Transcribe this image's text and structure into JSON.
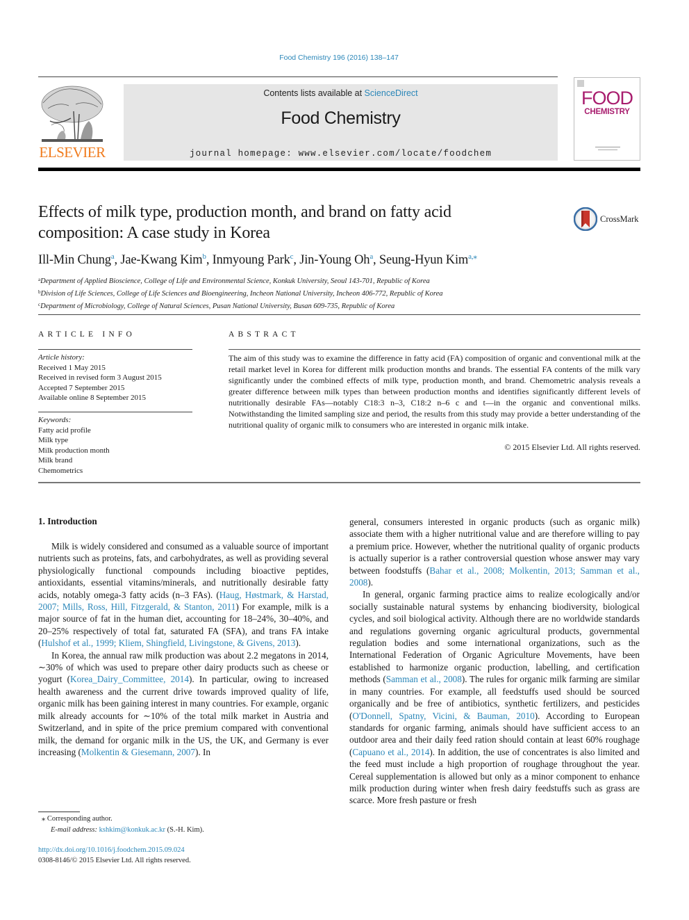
{
  "header": {
    "journal_ref": "Food Chemistry 196 (2016) 138–147",
    "contents_prefix": "Contents lists available at ",
    "contents_link": "ScienceDirect",
    "journal_title": "Food Chemistry",
    "homepage": "journal homepage: www.elsevier.com/locate/foodchem",
    "publisher_logo_text": "ELSEVIER",
    "cover_word_1": "FOOD",
    "cover_word_2": "CHEMISTRY",
    "crossmark_label": "CrossMark"
  },
  "colors": {
    "link": "#2a86b8",
    "elsevier_orange": "#f07b1d",
    "cover_magenta": "#a81d6e",
    "band_gray": "#e6e6e6"
  },
  "article": {
    "title": "Effects of milk type, production month, and brand on fatty acid composition: A case study in Korea",
    "authors": [
      {
        "name": "Ill-Min Chung",
        "aff": "a"
      },
      {
        "name": "Jae-Kwang Kim",
        "aff": "b"
      },
      {
        "name": "Inmyoung Park",
        "aff": "c"
      },
      {
        "name": "Jin-Young Oh",
        "aff": "a"
      },
      {
        "name": "Seung-Hyun Kim",
        "aff": "a,⁎"
      }
    ],
    "affiliations": [
      {
        "key": "a",
        "text": "Department of Applied Bioscience, College of Life and Environmental Science, Konkuk University, Seoul 143-701, Republic of Korea"
      },
      {
        "key": "b",
        "text": "Division of Life Sciences, College of Life Sciences and Bioengineering, Incheon National University, Incheon 406-772, Republic of Korea"
      },
      {
        "key": "c",
        "text": "Department of Microbiology, College of Natural Sciences, Pusan National University, Busan 609-735, Republic of Korea"
      }
    ]
  },
  "article_info": {
    "heading": "ARTICLE INFO",
    "history_label": "Article history:",
    "history": [
      "Received 1 May 2015",
      "Received in revised form 3 August 2015",
      "Accepted 7 September 2015",
      "Available online 8 September 2015"
    ],
    "keywords_label": "Keywords:",
    "keywords": [
      "Fatty acid profile",
      "Milk type",
      "Milk production month",
      "Milk brand",
      "Chemometrics"
    ]
  },
  "abstract": {
    "heading": "ABSTRACT",
    "text": "The aim of this study was to examine the difference in fatty acid (FA) composition of organic and conventional milk at the retail market level in Korea for different milk production months and brands. The essential FA contents of the milk vary significantly under the combined effects of milk type, production month, and brand. Chemometric analysis reveals a greater difference between milk types than between production months and identifies significantly different levels of nutritionally desirable FAs—notably C18:3 n–3, C18:2 n–6 c and t—in the organic and conventional milks. Notwithstanding the limited sampling size and period, the results from this study may provide a better understanding of the nutritional quality of organic milk to consumers who are interested in organic milk intake.",
    "copyright": "© 2015 Elsevier Ltd. All rights reserved."
  },
  "body": {
    "section_heading": "1. Introduction",
    "left": {
      "p1": [
        {
          "t": "Milk is widely considered and consumed as a valuable source of important nutrients such as proteins, fats, and carbohydrates, as well as providing several physiologically functional compounds including bioactive peptides, antioxidants, essential vitamins/minerals, and nutritionally desirable fatty acids, notably omega-3 fatty acids (n–3 FAs). ("
        },
        {
          "c": "Haug, Høstmark, & Harstad, 2007; Mills, Ross, Hill, Fitzgerald, & Stanton, 2011"
        },
        {
          "t": ") For example, milk is a major source of fat in the human diet, accounting for 18–24%, 30–40%, and 20–25% respectively of total fat, saturated FA (SFA), and trans FA intake ("
        },
        {
          "c": "Hulshof et al., 1999; Kliem, Shingfield, Livingstone, & Givens, 2013"
        },
        {
          "t": ")."
        }
      ],
      "p2": [
        {
          "t": "In Korea, the annual raw milk production was about 2.2 megatons in 2014, ∼30% of which was used to prepare other dairy products such as cheese or yogurt ("
        },
        {
          "c": "Korea_Dairy_Committee, 2014"
        },
        {
          "t": "). In particular, owing to increased health awareness and the current drive towards improved quality of life, organic milk has been gaining interest in many countries. For example, organic milk already accounts for ∼10% of the total milk market in Austria and Switzerland, and in spite of the price premium compared with conventional milk, the demand for organic milk in the US, the UK, and Germany is ever increasing ("
        },
        {
          "c": "Molkentin & Giesemann, 2007"
        },
        {
          "t": "). In"
        }
      ]
    },
    "right": {
      "p1": [
        {
          "t": "general, consumers interested in organic products (such as organic milk) associate them with a higher nutritional value and are therefore willing to pay a premium price. However, whether the nutritional quality of organic products is actually superior is a rather controversial question whose answer may vary between foodstuffs ("
        },
        {
          "c": "Bahar et al., 2008; Molkentin, 2013; Samman et al., 2008"
        },
        {
          "t": ")."
        }
      ],
      "p2": [
        {
          "t": "In general, organic farming practice aims to realize ecologically and/or socially sustainable natural systems by enhancing biodiversity, biological cycles, and soil biological activity. Although there are no worldwide standards and regulations governing organic agricultural products, governmental regulation bodies and some international organizations, such as the International Federation of Organic Agriculture Movements, have been established to harmonize organic production, labelling, and certification methods ("
        },
        {
          "c": "Samman et al., 2008"
        },
        {
          "t": "). The rules for organic milk farming are similar in many countries. For example, all feedstuffs used should be sourced organically and be free of antibiotics, synthetic fertilizers, and pesticides ("
        },
        {
          "c": "O'Donnell, Spatny, Vicini, & Bauman, 2010"
        },
        {
          "t": "). According to European standards for organic farming, animals should have sufficient access to an outdoor area and their daily feed ration should contain at least 60% roughage ("
        },
        {
          "c": "Capuano et al., 2014"
        },
        {
          "t": "). In addition, the use of concentrates is also limited and the feed must include a high proportion of roughage throughout the year. Cereal supplementation is allowed but only as a minor component to enhance milk production during winter when fresh dairy feedstuffs such as grass are scarce. More fresh pasture or fresh"
        }
      ]
    }
  },
  "footnotes": {
    "corresponding_mark": "⁎",
    "corresponding": "Corresponding author.",
    "email_label": "E-mail address: ",
    "email": "kshkim@konkuk.ac.kr",
    "email_suffix": " (S.-H. Kim).",
    "doi": "http://dx.doi.org/10.1016/j.foodchem.2015.09.024",
    "issn_line": "0308-8146/© 2015 Elsevier Ltd. All rights reserved."
  }
}
